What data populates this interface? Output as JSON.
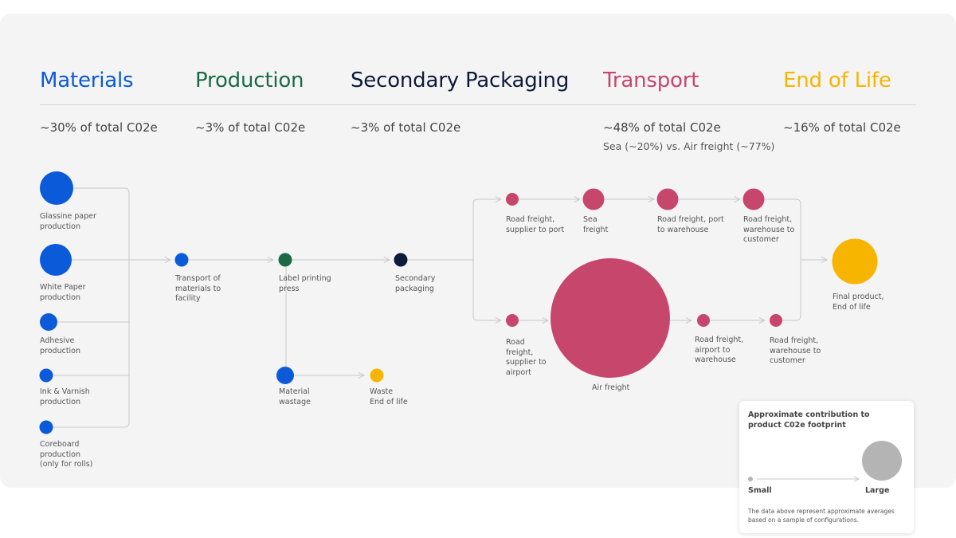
{
  "colors": {
    "materials": "#0b5ad9",
    "production": "#1a6b45",
    "packaging": "#0d1b3a",
    "transport": "#c7466c",
    "end_of_life": "#f7b500",
    "line": "#c8c8c8",
    "legend_circle": "#b4b4b4"
  },
  "stages": [
    {
      "title": "Materials",
      "share": "~30% of total C02e"
    },
    {
      "title": "Production",
      "share": "~3% of total C02e"
    },
    {
      "title": "Secondary Packaging",
      "share": "~3% of total C02e"
    },
    {
      "title": "Transport",
      "share": "~48% of total C02e",
      "detail": "Sea (~20%) vs. Air freight (~77%)"
    },
    {
      "title": "End of Life",
      "share": "~16% of total C02e"
    }
  ],
  "nodes": {
    "glassine": "Glassine paper\nproduction",
    "white_paper": "White Paper\nproduction",
    "adhesive": "Adhesive\nproduction",
    "ink": "Ink & Varnish\nproduction",
    "coreboard": "Coreboard\nproduction\n(only for rolls)",
    "transport_materials": "Transport of\nmaterials to\nfacility",
    "label_press": "Label printing\npress",
    "material_wastage": "Material\nwastage",
    "waste_eol": "Waste\nEnd of life",
    "secondary_packaging": "Secondary\npackaging",
    "road_supplier_port": "Road freight,\nsupplier to port",
    "sea_freight": "Sea\nfreight",
    "road_port_warehouse": "Road freight, port\nto warehouse",
    "road_warehouse_customer_sea": "Road freight,\nwarehouse to\ncustomer",
    "road_supplier_airport": "Road\nfreight,\nsupplier to\nairport",
    "air_freight": "Air freight",
    "road_airport_warehouse": "Road freight,\nairport to\nwarehouse",
    "road_warehouse_customer_air": "Road freight,\nwarehouse to\ncustomer",
    "final_product": "Final product,\nEnd of life"
  },
  "legend": {
    "title": "Approximate contribution to\nproduct C02e footprint",
    "small": "Small",
    "large": "Large",
    "note": "The data above represent approximate averages\nbased on a sample of configurations."
  }
}
